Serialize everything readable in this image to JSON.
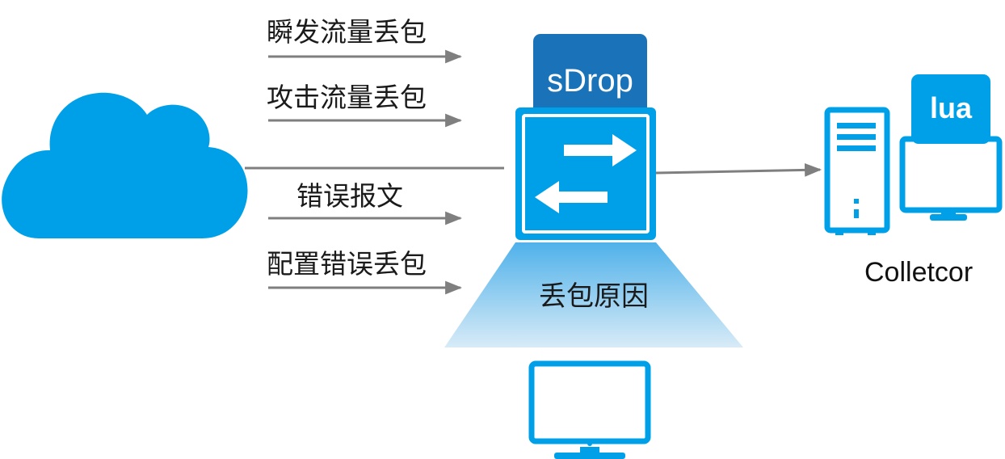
{
  "diagram": {
    "flows": [
      {
        "label": "瞬发流量丢包"
      },
      {
        "label": "攻击流量丢包"
      },
      {
        "label": "错误报文"
      },
      {
        "label": "配置错误丢包"
      }
    ],
    "switch_title": "sDrop",
    "drop_reason_label": "丢包原因",
    "collector_badge": "lua",
    "collector_label": "Colletcor"
  },
  "colors": {
    "accent": "#00a0e9",
    "badge_dark": "#1a73b8",
    "arrow_gray": "#7f7f7f",
    "beam_top": "#4fb1ea",
    "beam_bottom": "#d8ebf7"
  }
}
